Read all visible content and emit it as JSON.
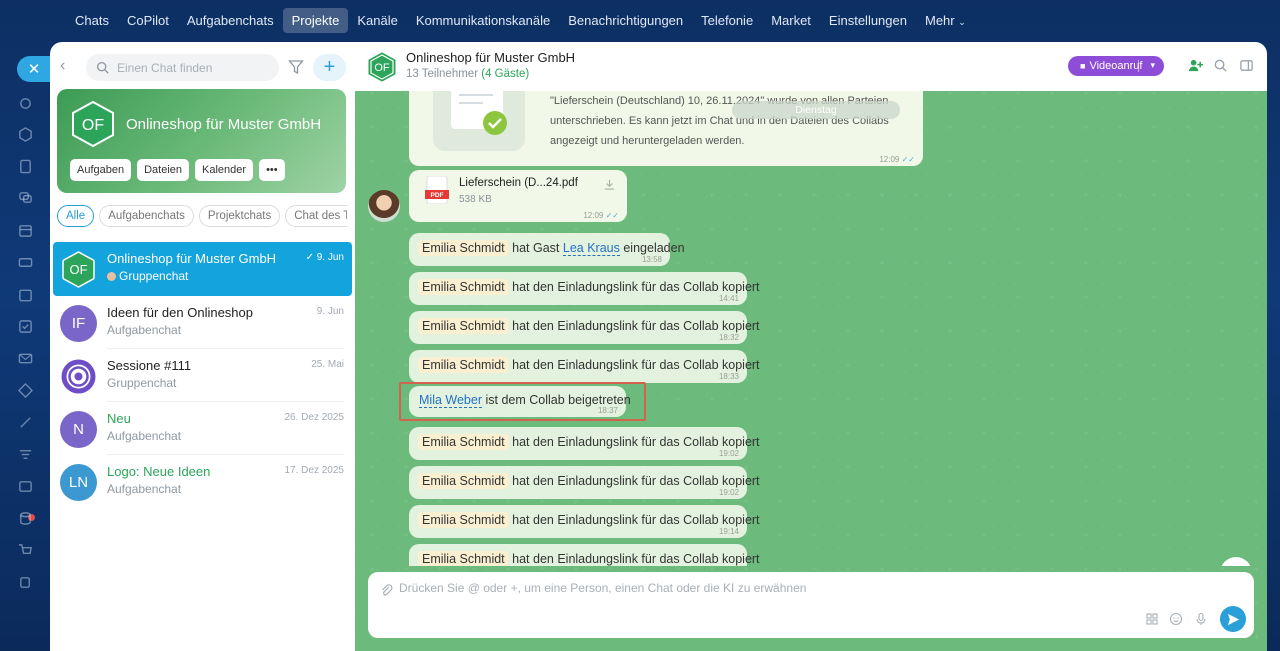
{
  "topnav": {
    "items": [
      "Chats",
      "CoPilot",
      "Aufgabenchats",
      "Projekte",
      "Kanäle",
      "Kommunikationskanäle",
      "Benachrichtigungen",
      "Telefonie",
      "Market",
      "Einstellungen",
      "Mehr"
    ],
    "active": "Projekte"
  },
  "sidebar": {
    "search_placeholder": "Einen Chat finden",
    "hero": {
      "initials": "OF",
      "title": "Onlineshop für Muster GmbH",
      "buttons": [
        "Aufgaben",
        "Dateien",
        "Kalender",
        "•••"
      ]
    },
    "filters": [
      "Alle",
      "Aufgabenchats",
      "Projektchats",
      "Chat des Te"
    ],
    "chats": [
      {
        "initials": "OF",
        "name": "Onlineshop für Muster GmbH",
        "sub": "Gruppenchat",
        "date": "9. Jun",
        "color": "#2ca55a"
      },
      {
        "initials": "IF",
        "name": "Ideen für den Onlineshop",
        "sub": "Aufgabenchat",
        "date": "9. Jun",
        "color": "#7a66c8"
      },
      {
        "initials": "",
        "name": "Sessione #111",
        "sub": "Gruppenchat",
        "date": "25. Mai",
        "color": "#6d4ec7"
      },
      {
        "initials": "N",
        "name": "Neu",
        "sub": "Aufgabenchat",
        "date": "26. Dez 2025",
        "color": "#7a66c8"
      },
      {
        "initials": "LN",
        "name": "Logo: Neue Ideen",
        "sub": "Aufgabenchat",
        "date": "17. Dez 2025",
        "color": "#3c98d0"
      }
    ]
  },
  "chat": {
    "initials": "OF",
    "title": "Onlineshop für Muster GmbH",
    "participants": "13 Teilnehmer",
    "guests": "(4 Gäste)",
    "video_label": "Videoanruf",
    "date_pill": "Dienstag",
    "doc_message": {
      "text": "\"Lieferschein (Deutschland) 10, 26.11.2024\" wurde von allen Parteien unterschrieben. Es kann jetzt im Chat und in den Dateien des Collabs angezeigt und heruntergeladen werden.",
      "time": "12:09"
    },
    "file_message": {
      "badge": "PDF",
      "name": "Lieferschein (D...24.pdf",
      "size": "538 KB",
      "time": "12:09"
    },
    "system_messages": [
      {
        "actor": "Emilia Schmidt",
        "pre": "hat Gast",
        "link": "Lea Kraus",
        "post": "eingeladen",
        "time": "13:58"
      },
      {
        "actor": "Emilia Schmidt",
        "text": "hat den Einladungslink für das Collab kopiert",
        "time": "14:41"
      },
      {
        "actor": "Emilia Schmidt",
        "text": "hat den Einladungslink für das Collab kopiert",
        "time": "18:32"
      },
      {
        "actor": "Emilia Schmidt",
        "text": "hat den Einladungslink für das Collab kopiert",
        "time": "18:33"
      },
      {
        "link": "Mila Weber",
        "text": "ist dem Collab beigetreten",
        "time": "18:37"
      },
      {
        "actor": "Emilia Schmidt",
        "text": "hat den Einladungslink für das Collab kopiert",
        "time": "19:02"
      },
      {
        "actor": "Emilia Schmidt",
        "text": "hat den Einladungslink für das Collab kopiert",
        "time": "19:02"
      },
      {
        "actor": "Emilia Schmidt",
        "text": "hat den Einladungslink für das Collab kopiert",
        "time": "19:14"
      },
      {
        "actor": "Emilia Schmidt",
        "text": "hat den Einladungslink für das Collab kopiert",
        "time": ""
      }
    ],
    "composer_placeholder": "Drücken Sie @ oder +, um eine Person, einen Chat oder die KI zu erwähnen"
  },
  "colors": {
    "accent": "#2b9fd8",
    "brand_green": "#2ca55a",
    "video": "#8e4dd8",
    "highlight": "#d4634d"
  },
  "icons": [
    "close-icon",
    "search-icon",
    "filter-icon",
    "plus-icon",
    "back-icon",
    "video-icon",
    "add-user-icon",
    "sidebar-toggle-icon",
    "download-icon",
    "attach-icon",
    "apps-icon",
    "emoji-icon",
    "mic-icon",
    "send-icon",
    "chevron-down-icon"
  ]
}
